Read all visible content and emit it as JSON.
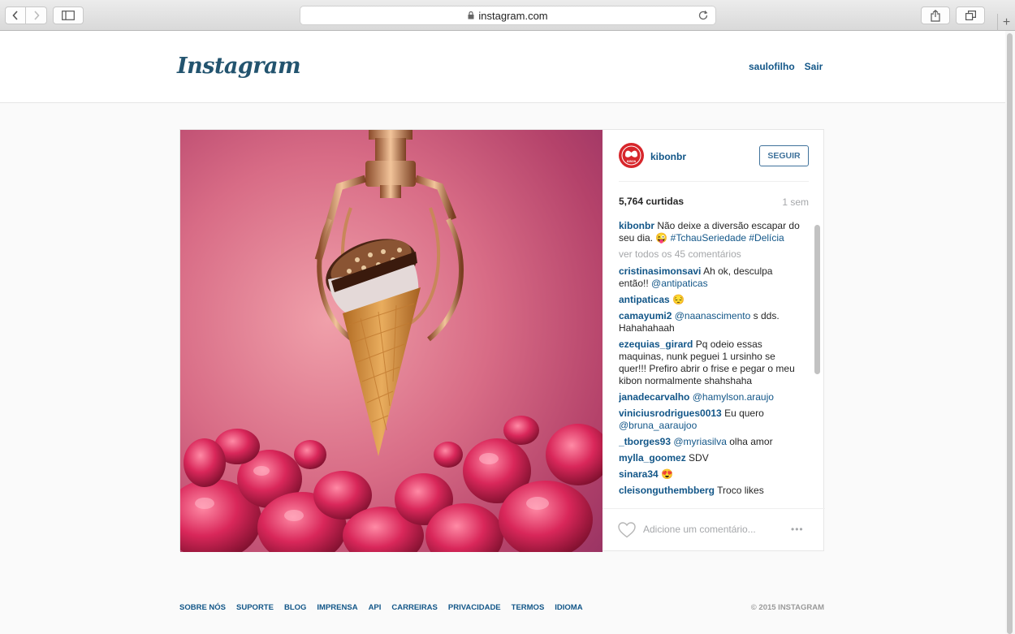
{
  "browser": {
    "url": "instagram.com"
  },
  "header": {
    "logo": "Instagram",
    "username": "saulofilho",
    "logout": "Sair"
  },
  "post": {
    "author": "kibonbr",
    "avatar_text": "KIBON",
    "follow_label": "SEGUIR",
    "likes": "5,764 curtidas",
    "age": "1 sem",
    "caption": {
      "author": "kibonbr",
      "text": " Não deixe a diversão escapar do seu dia. 😜 ",
      "tags": "#TchauSeriedade #Delícia"
    },
    "view_all": "ver todos os 45 comentários",
    "comments": [
      {
        "author": "cristinasimonsavi",
        "text": " Ah ok, desculpa então!! ",
        "mention": "@antipaticas"
      },
      {
        "author": "antipaticas",
        "text": " 😔",
        "mention": ""
      },
      {
        "author": "camayumi2",
        "text": " s dds. Hahahahaah",
        "mention": "@naanascimento",
        "mention_first": true
      },
      {
        "author": "ezequias_girard",
        "text": " Pq odeio essas maquinas, nunk peguei 1 ursinho se quer!!! Prefiro abrir o frise e pegar o meu kibon normalmente shahshaha",
        "mention": ""
      },
      {
        "author": "janadecarvalho",
        "text": " ",
        "mention": "@hamylson.araujo"
      },
      {
        "author": "viniciusrodrigues0013",
        "text": " Eu quero ",
        "mention": "@bruna_aaraujoo"
      },
      {
        "author": "_tborges93",
        "text": " olha amor",
        "mention": "@myriasilva",
        "mention_first": true
      },
      {
        "author": "mylla_goomez",
        "text": " SDV",
        "mention": ""
      },
      {
        "author": "sinara34",
        "text": " 😍",
        "mention": ""
      },
      {
        "author": "cleisonguthembberg",
        "text": " Troco likes",
        "mention": ""
      }
    ],
    "comment_placeholder": "Adicione um comentário...",
    "more": "•••"
  },
  "footer": {
    "links": [
      "SOBRE NÓS",
      "SUPORTE",
      "BLOG",
      "IMPRENSA",
      "API",
      "CARREIRAS",
      "PRIVACIDADE",
      "TERMOS",
      "IDIOMA"
    ],
    "copyright": "© 2015 INSTAGRAM"
  },
  "colors": {
    "link": "#125688",
    "logo": "#23546f",
    "follow": "#3f729b"
  }
}
